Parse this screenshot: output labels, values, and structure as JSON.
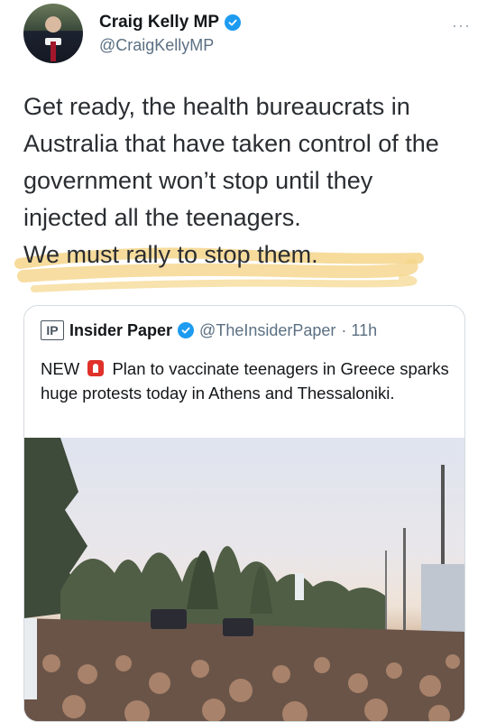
{
  "author": {
    "display_name": "Craig Kelly MP",
    "handle": "@CraigKellyMP",
    "verified": true,
    "more_menu": "···"
  },
  "tweet": {
    "lines": [
      "Get ready, the health bureaucrats in",
      "Australia that have taken control of the",
      "government won’t stop until they",
      "injected all the teenagers."
    ],
    "highlighted_line": "We must rally to stop them.",
    "highlight_color": "#f5d58a"
  },
  "quoted_tweet": {
    "logo_text": "IP",
    "display_name": "Insider Paper",
    "handle": "@TheInsiderPaper",
    "time": "· 11h",
    "text_prefix": "NEW",
    "siren_icon": "police-light-icon",
    "text_body": "Plan to vaccinate teenagers in Greece sparks huge protests today in Athens and Thessaloniki."
  },
  "colors": {
    "verified_blue": "#1d9bf0",
    "secondary_text": "#5b7083",
    "border": "#d5dbe0"
  }
}
